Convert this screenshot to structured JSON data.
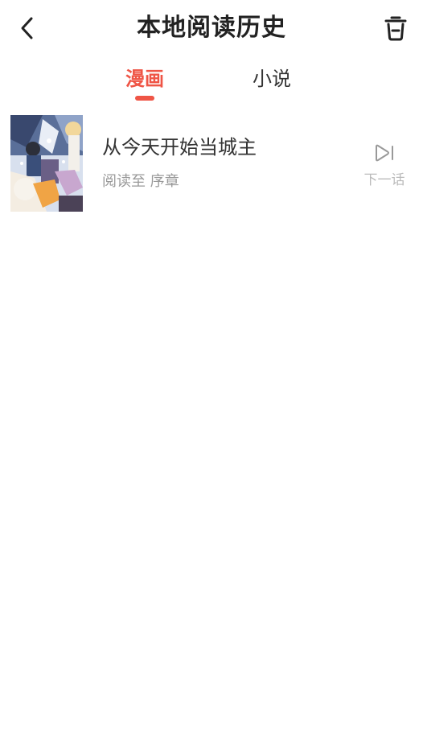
{
  "header": {
    "title": "本地阅读历史",
    "back_icon": "chevron-left-icon",
    "trash_icon": "trash-icon"
  },
  "tabs": [
    {
      "label": "漫画",
      "active": true
    },
    {
      "label": "小说",
      "active": false
    }
  ],
  "history": [
    {
      "title": "从今天开始当城主",
      "progress": "阅读至 序章",
      "next_label": "下一话",
      "next_icon": "play-next-icon"
    }
  ],
  "colors": {
    "accent": "#ef5546",
    "title_text": "#222222",
    "secondary_text": "#999999",
    "disabled_text": "#bbbbbb"
  }
}
